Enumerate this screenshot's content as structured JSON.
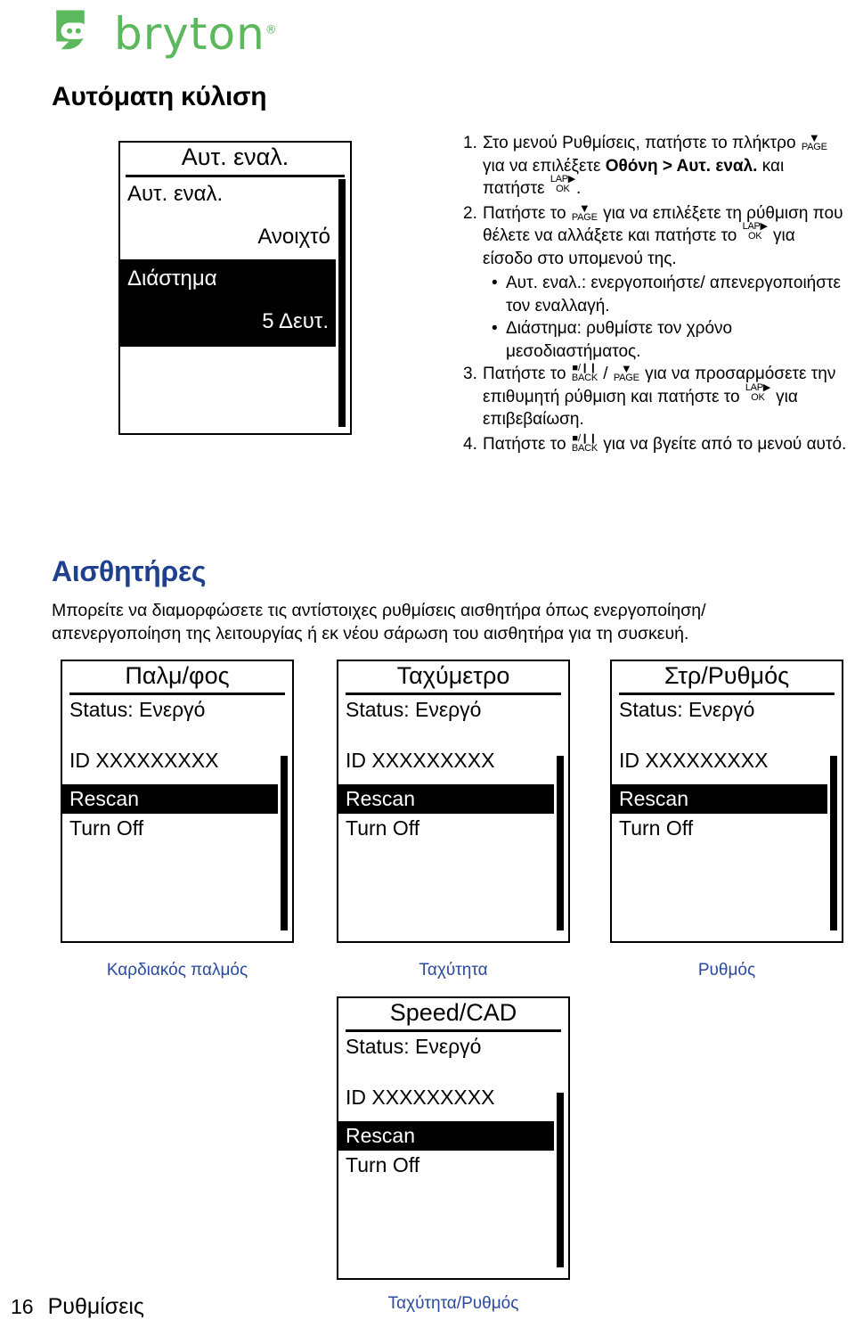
{
  "brand": {
    "name": "bryton",
    "registered": "®",
    "logo_icon": "bryton-bird-logo",
    "color": "#5cb85c"
  },
  "headings": {
    "autoscroll": "Αυτόματη κύλιση",
    "sensors": "Αισθητήρες",
    "sensors_color": "#1f3f8f"
  },
  "sensors_intro": "Μπορείτε να διαμορφώσετε τις αντίστοιχες ρυθμίσεις αισθητήρα όπως ενεργοποίηση/ απενεργοποίηση της λειτουργίας ή εκ νέου σάρωση του αισθητήρα για τη συσκευή.",
  "keys": {
    "page": {
      "glyph": "▼",
      "label": "PAGE"
    },
    "lap_ok": {
      "glyph": "LAP▶",
      "label": "OK"
    },
    "back": {
      "glyph": "■/❙❙",
      "label": "BACK"
    }
  },
  "autoscroll_device": {
    "title": "Αυτ. εναλ.",
    "rows": [
      {
        "label": "Αυτ. εναλ.",
        "value": "Ανοιχτό",
        "selected": false
      },
      {
        "label": "Διάστημα",
        "value": "5 Δευτ.",
        "selected": true
      }
    ]
  },
  "instructions": [
    {
      "num": "1.",
      "parts": [
        {
          "t": "text",
          "v": "Στο μενού Ρυθμίσεις, πατήστε το πλήκτρο "
        },
        {
          "t": "key",
          "v": "page"
        },
        {
          "t": "text",
          "v": " για να επιλέξετε "
        },
        {
          "t": "bold",
          "v": "Οθόνη > Αυτ. εναλ."
        },
        {
          "t": "text",
          "v": " και πατήστε "
        },
        {
          "t": "key",
          "v": "lap_ok"
        },
        {
          "t": "text",
          "v": "."
        }
      ]
    },
    {
      "num": "2.",
      "parts": [
        {
          "t": "text",
          "v": "Πατήστε το "
        },
        {
          "t": "key",
          "v": "page"
        },
        {
          "t": "text",
          "v": " για να επιλέξετε τη ρύθμιση που θέλετε να αλλάξετε και πατήστε το "
        },
        {
          "t": "key",
          "v": "lap_ok"
        },
        {
          "t": "text",
          "v": " για είσοδο στο υπομενού της."
        }
      ],
      "sub": [
        "Αυτ. εναλ.: ενεργοποιήστε/ απενεργοποιήστε τον εναλλαγή.",
        "Διάστημα: ρυθμίστε τον χρόνο μεσοδιαστήματος."
      ]
    },
    {
      "num": "3.",
      "parts": [
        {
          "t": "text",
          "v": "Πατήστε το "
        },
        {
          "t": "key",
          "v": "back"
        },
        {
          "t": "text",
          "v": " / "
        },
        {
          "t": "key",
          "v": "page"
        },
        {
          "t": "text",
          "v": " για να προσαρμόσετε την επιθυμητή ρύθμιση και πατήστε το "
        },
        {
          "t": "key",
          "v": "lap_ok"
        },
        {
          "t": "text",
          "v": " για επιβεβαίωση."
        }
      ]
    },
    {
      "num": "4.",
      "parts": [
        {
          "t": "text",
          "v": "Πατήστε το "
        },
        {
          "t": "key",
          "v": "back"
        },
        {
          "t": "text",
          "v": " για να βγείτε από το μενού αυτό."
        }
      ]
    }
  ],
  "sensor_screens": [
    {
      "id": "hr",
      "title": "Παλμ/φος",
      "status": "Status: Ενεργό",
      "device_id": "ID XXXXXXXXX",
      "rescan": "Rescan",
      "turn_off": "Turn Off",
      "caption": "Καρδιακός παλμός"
    },
    {
      "id": "speed",
      "title": "Ταχύμετρο",
      "status": "Status: Ενεργό",
      "device_id": "ID XXXXXXXXX",
      "rescan": "Rescan",
      "turn_off": "Turn Off",
      "caption": "Ταχύτητα"
    },
    {
      "id": "cad",
      "title": "Στρ/Ρυθμός",
      "status": "Status: Ενεργό",
      "device_id": "ID XXXXXXXXX",
      "rescan": "Rescan",
      "turn_off": "Turn Off",
      "caption": "Ρυθμός"
    },
    {
      "id": "speedcad",
      "title": "Speed/CAD",
      "status": "Status: Ενεργό",
      "device_id": "ID XXXXXXXXX",
      "rescan": "Rescan",
      "turn_off": "Turn Off",
      "caption": "Ταχύτητα/Ρυθμός"
    }
  ],
  "footer": {
    "page_number": "16",
    "section": "Ρυθμίσεις"
  }
}
